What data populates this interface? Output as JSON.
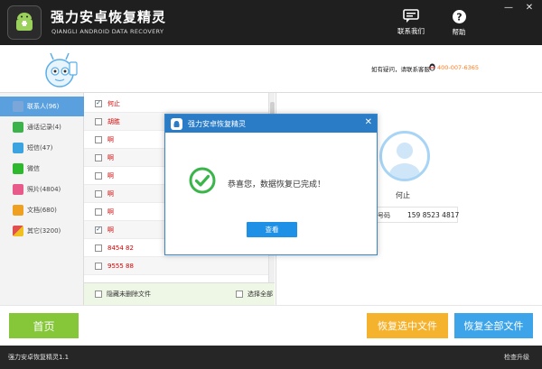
{
  "app": {
    "title": "强力安卓恢复精灵",
    "subtitle": "QIANGLI ANDROID DATA RECOVERY"
  },
  "window_controls": {
    "minimize": "—",
    "close": "✕"
  },
  "toolbar": {
    "contact_label": "联系我们",
    "help_label": "帮助"
  },
  "header": {
    "help_text": "如有疑问，请联系客服",
    "phone": "400-007-6365"
  },
  "sidebar": {
    "items": [
      {
        "label": "联系人(96)",
        "icon": "contacts-icon",
        "color": "#7aa6d9",
        "active": true
      },
      {
        "label": "通话记录(4)",
        "icon": "call-log-icon",
        "color": "#3cb34a",
        "active": false
      },
      {
        "label": "短信(47)",
        "icon": "sms-icon",
        "color": "#3aa3e0",
        "active": false
      },
      {
        "label": "微信",
        "icon": "wechat-icon",
        "color": "#2eb82e",
        "active": false
      },
      {
        "label": "照片(4804)",
        "icon": "photo-icon",
        "color": "#e85a8a",
        "active": false
      },
      {
        "label": "文档(680)",
        "icon": "document-icon",
        "color": "#f0a020",
        "active": false
      },
      {
        "label": "其它(3200)",
        "icon": "other-icon",
        "color": "#e05050",
        "active": false
      }
    ]
  },
  "list": {
    "rows": [
      {
        "text": "何止",
        "checked": true
      },
      {
        "text": "胡胜",
        "checked": false
      },
      {
        "text": "啊",
        "checked": false
      },
      {
        "text": "啊",
        "checked": false
      },
      {
        "text": "啊",
        "checked": false
      },
      {
        "text": "啊",
        "checked": false
      },
      {
        "text": "啊",
        "checked": false
      },
      {
        "text": "啊",
        "checked": true
      },
      {
        "text": "8454 82",
        "checked": false
      },
      {
        "text": "9555 88",
        "checked": false
      }
    ],
    "footer_left": "隐藏未删除文件",
    "footer_right": "选择全部"
  },
  "detail": {
    "name": "何止",
    "phone_label": "号码",
    "phone_value": "159 8523 4817"
  },
  "modal": {
    "title": "强力安卓恢复精灵",
    "close": "✕",
    "message": "恭喜您，数据恢复已完成！",
    "button": "查看"
  },
  "buttons": {
    "home": "首页",
    "recover_selected": "恢复选中文件",
    "recover_all": "恢复全部文件"
  },
  "status": {
    "version": "强力安卓恢复精灵1.1",
    "update": "检查升级"
  },
  "colors": {
    "accent": "#2a7cc7",
    "home_button": "#86c73a",
    "recover_selected": "#f5b22d",
    "recover_all": "#3ea4ea",
    "list_text": "#d40000"
  }
}
